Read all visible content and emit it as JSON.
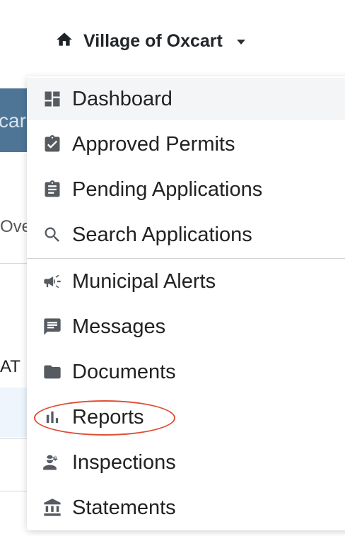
{
  "header": {
    "title": "Village of Oxcart",
    "home_icon": "home-icon"
  },
  "background": {
    "banner_text": "car",
    "text1": "Ove",
    "text2": "AT"
  },
  "menu": {
    "items": [
      {
        "label": "Dashboard",
        "icon": "dashboard-icon"
      },
      {
        "label": "Approved Permits",
        "icon": "clipboard-check-icon"
      },
      {
        "label": "Pending Applications",
        "icon": "clipboard-list-icon"
      },
      {
        "label": "Search Applications",
        "icon": "search-icon"
      },
      {
        "label": "Municipal Alerts",
        "icon": "megaphone-icon"
      },
      {
        "label": "Messages",
        "icon": "message-icon"
      },
      {
        "label": "Documents",
        "icon": "folder-icon"
      },
      {
        "label": "Reports",
        "icon": "bar-chart-icon"
      },
      {
        "label": "Inspections",
        "icon": "inspector-icon"
      },
      {
        "label": "Statements",
        "icon": "bank-icon"
      }
    ]
  },
  "colors": {
    "banner": "#4e7596",
    "annotation": "#e04e35",
    "icon": "#555b61"
  }
}
